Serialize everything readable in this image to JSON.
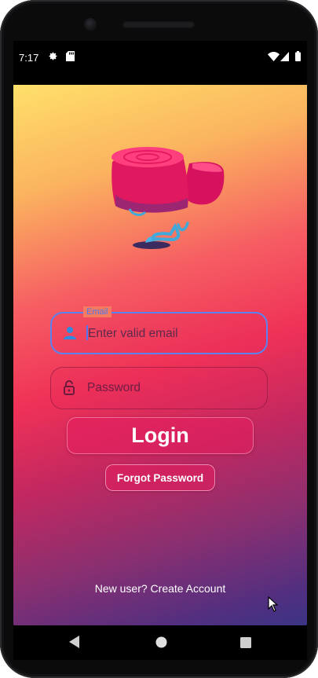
{
  "status_bar": {
    "time": "7:17",
    "icons": [
      "gear-icon",
      "sd-card-icon",
      "wifi-icon",
      "signal-icon",
      "battery-icon"
    ]
  },
  "illustration": {
    "icon": "tree-stump-pink-illustration"
  },
  "email_field": {
    "label": "Email",
    "placeholder": "Enter valid email",
    "value": "",
    "icon": "person-icon",
    "accent_color": "#4e76f0"
  },
  "password_field": {
    "placeholder": "Password",
    "value": "",
    "icon": "lock-icon"
  },
  "buttons": {
    "login": "Login",
    "forgot_password": "Forgot Password"
  },
  "footer": {
    "create_account": "New user? Create Account"
  },
  "colors": {
    "gradient_top": "#ffe06a",
    "gradient_mid": "#ef3157",
    "gradient_bottom": "#3b3485"
  },
  "nav_bar": {
    "icons": [
      "back-icon",
      "home-icon",
      "recents-icon"
    ]
  }
}
